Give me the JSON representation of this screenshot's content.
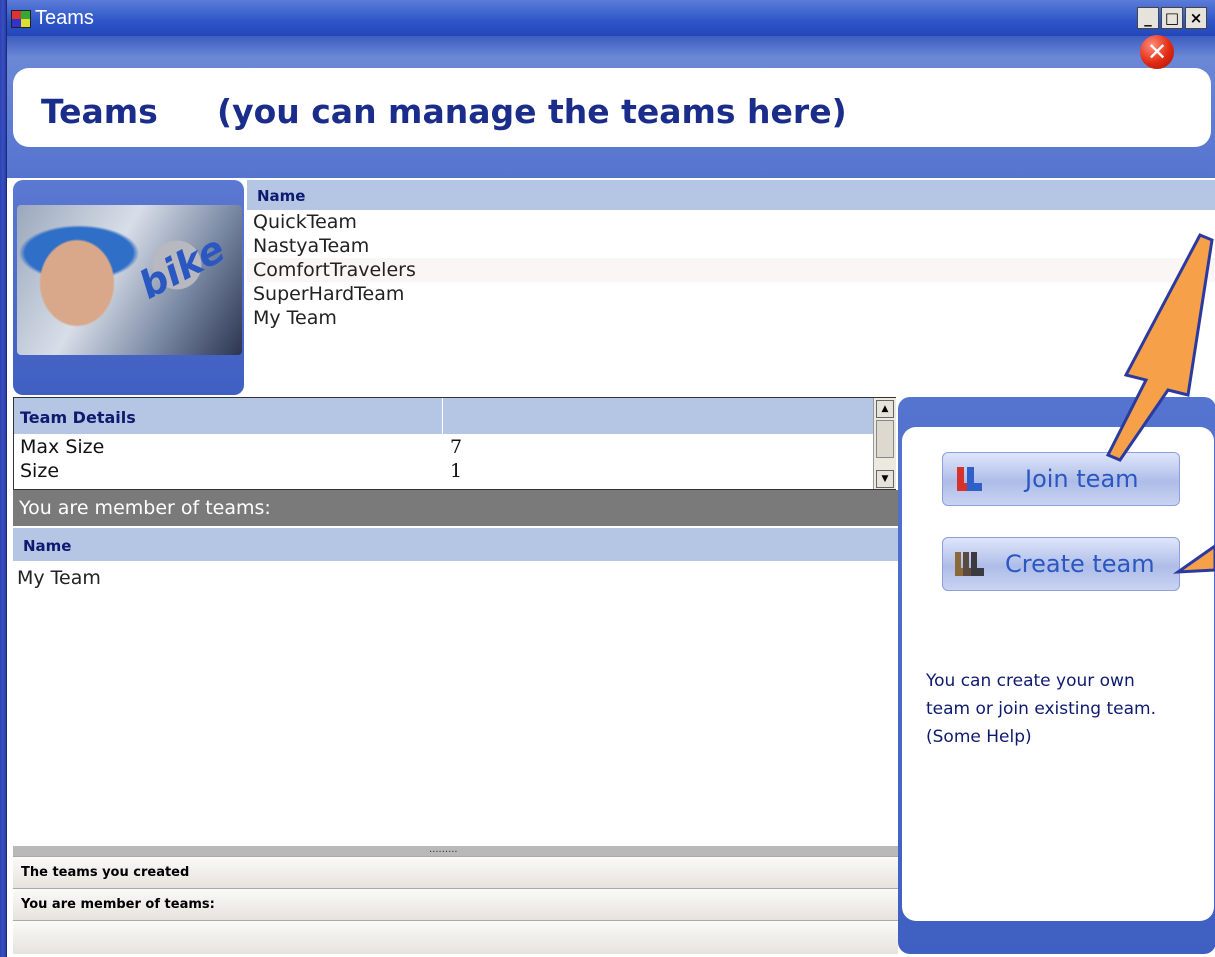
{
  "window": {
    "title": "Teams",
    "minimize": "_",
    "maximize": "□",
    "close": "×"
  },
  "header": {
    "title": "Teams",
    "subtitle": "(you can manage the teams here)"
  },
  "avatar": {
    "overlay_text": "bike"
  },
  "teams_list": {
    "column_header": "Name",
    "rows": [
      "QuickTeam",
      "NastyaTeam",
      "ComfortTravelers",
      "SuperHardTeam",
      "My Team"
    ]
  },
  "team_details": {
    "header": "Team Details",
    "rows": [
      {
        "label": "Max Size",
        "value": "7"
      },
      {
        "label": "Size",
        "value": "1"
      }
    ]
  },
  "member_section": {
    "banner": "You are member of teams:",
    "column_header": "Name",
    "rows": [
      "My Team"
    ],
    "splitter_dots": "........."
  },
  "tabs": [
    "The teams you created",
    "You are member of teams:"
  ],
  "actions": {
    "join_label": "Join team",
    "create_label": "Create team"
  },
  "help_text": "You can create your own team or join existing team. (Some Help)",
  "colors": {
    "accent": "#1a2d8a",
    "button_text": "#2a57c2",
    "arrow_fill": "#f7a04a"
  }
}
